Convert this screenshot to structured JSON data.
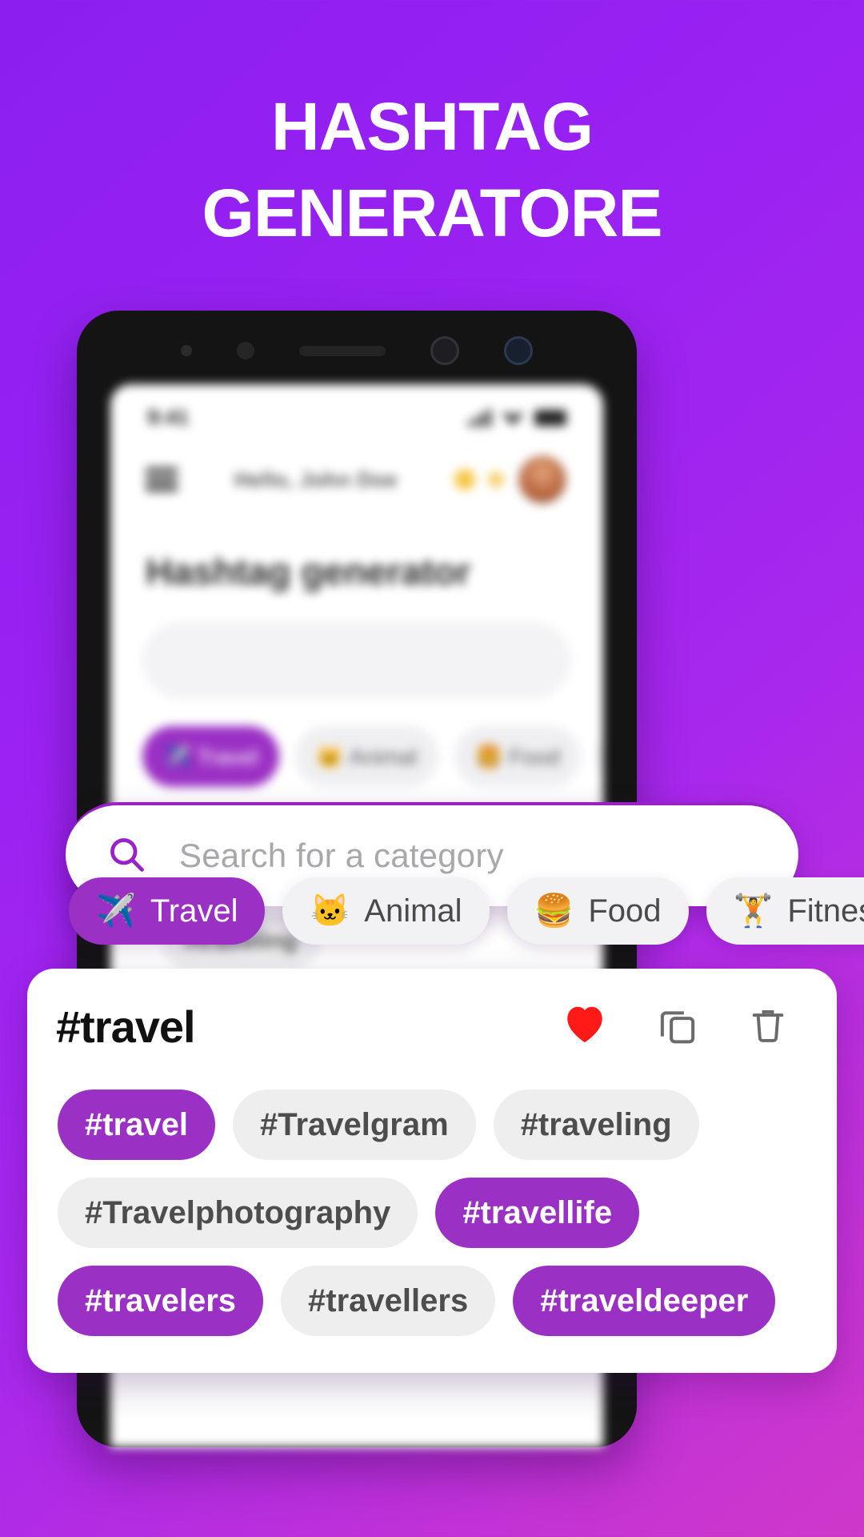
{
  "poster": {
    "title_line1": "HASHTAG",
    "title_line2": "GENERATORE",
    "accent_color": "#9b30c4",
    "background_start": "#8b1ff0",
    "background_end": "#cf38c9"
  },
  "phone": {
    "status_bar": {
      "time": "9:41"
    },
    "app_bar": {
      "greeting": "Hello, John Doe"
    },
    "screen_heading": "Hashtag generator"
  },
  "search": {
    "placeholder": "Search for a category",
    "icon": "search-icon"
  },
  "categories": [
    {
      "label": "Travel",
      "emoji": "✈️",
      "icon": "airplane-icon",
      "selected": true
    },
    {
      "label": "Animal",
      "emoji": "🐱",
      "icon": "cat-icon",
      "selected": false
    },
    {
      "label": "Food",
      "emoji": "🍔",
      "icon": "hamburger-icon",
      "selected": false
    },
    {
      "label": "Fitness",
      "emoji": "🏋️",
      "icon": "dumbbell-icon",
      "selected": false
    }
  ],
  "result_card": {
    "title": "#travel",
    "actions": [
      {
        "name": "favorite-button",
        "icon": "heart-icon",
        "glyph": "♥",
        "color": "#ff1a17"
      },
      {
        "name": "copy-button",
        "icon": "copy-icon"
      },
      {
        "name": "delete-button",
        "icon": "trash-icon"
      }
    ],
    "hashtags": [
      {
        "label": "#travel",
        "active": true
      },
      {
        "label": "#Travelgram",
        "active": false
      },
      {
        "label": "#traveling",
        "active": false
      },
      {
        "label": "#Travelphotography",
        "active": false
      },
      {
        "label": "#travellife",
        "active": true
      },
      {
        "label": "#travelers",
        "active": true
      },
      {
        "label": "#travellers",
        "active": false
      },
      {
        "label": "#traveldeeper",
        "active": true
      }
    ]
  }
}
